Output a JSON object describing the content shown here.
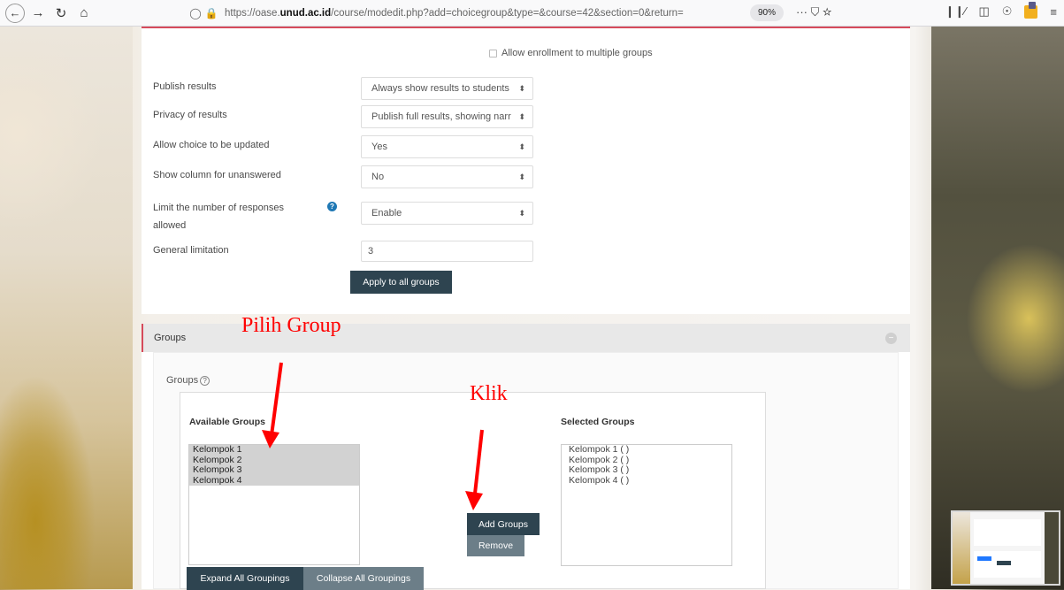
{
  "browser": {
    "url_prefix": "https://oase.",
    "url_domain": "unud.ac.id",
    "url_path": "/course/modedit.php?add=choicegroup&type=&course=42&section=0&return=",
    "zoom": "90%",
    "url_actions": "··· ⛉ ☆"
  },
  "settings": {
    "allow_multiple_label": "Allow enrollment to multiple groups",
    "publish_results_label": "Publish results",
    "publish_results_value": "Always show results to students",
    "privacy_label": "Privacy of results",
    "privacy_value": "Publish full results, showing narr",
    "allow_update_label": "Allow choice to be updated",
    "allow_update_value": "Yes",
    "show_unanswered_label": "Show column for unanswered",
    "show_unanswered_value": "No",
    "limit_label_line1": "Limit the number of responses",
    "limit_label_line2": "allowed",
    "limit_value": "Enable",
    "general_limit_label": "General limitation",
    "general_limit_value": "3",
    "apply_button": "Apply to all groups"
  },
  "groups_section": {
    "header": "Groups",
    "field_label": "Groups",
    "available_header": "Available Groups",
    "selected_header": "Selected Groups",
    "available": [
      "Kelompok 1",
      "Kelompok 2",
      "Kelompok 3",
      "Kelompok 4"
    ],
    "selected": [
      "Kelompok 1 ( )",
      "Kelompok 2 ( )",
      "Kelompok 3 ( )",
      "Kelompok 4 ( )"
    ],
    "add_button": "Add Groups",
    "remove_button": "Remove",
    "expand_button": "Expand All Groupings",
    "collapse_button": "Collapse All Groupings"
  },
  "annotations": {
    "pick_group": "Pilih Group",
    "click": "Klik",
    "color": "#ff0000"
  }
}
